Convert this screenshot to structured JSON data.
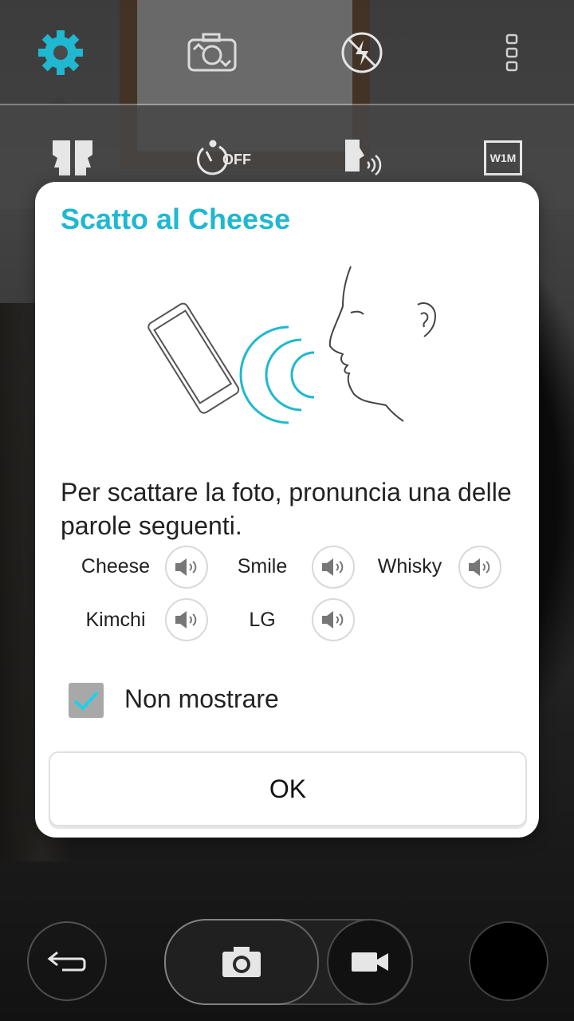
{
  "app": {
    "accent_color": "#1fb8d0"
  },
  "top_bar": {
    "icons": [
      "gear-icon",
      "switch-camera-icon",
      "flash-off-icon",
      "more-vert-icon"
    ]
  },
  "sub_bar": {
    "icons": [
      "face-mode-icon",
      "timer-icon",
      "cheese-shutter-icon",
      "resolution-icon"
    ],
    "timer_text": "OFF",
    "resolution_text": "W1M"
  },
  "dialog": {
    "title": "Scatto al Cheese",
    "description": "Per scattare la foto, pronuncia una delle parole seguenti.",
    "words": [
      "Cheese",
      "Smile",
      "Whisky",
      "Kimchi",
      "LG"
    ],
    "checkbox_label": "Non mostrare",
    "checkbox_checked": true,
    "ok_label": "OK"
  },
  "bottom_bar": {
    "icons": [
      "back-icon",
      "camera-icon",
      "video-icon",
      "gallery-thumbnail"
    ]
  }
}
